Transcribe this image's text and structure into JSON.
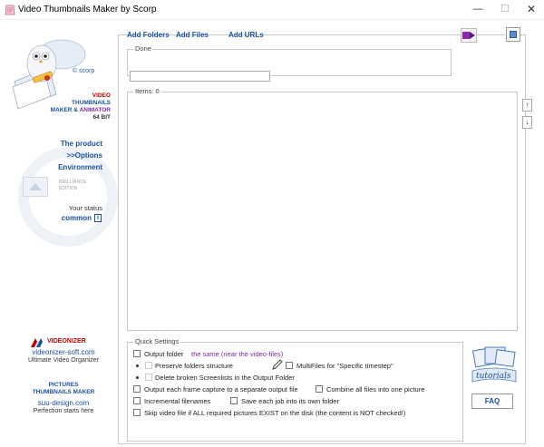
{
  "window": {
    "title": "Video Thumbnails Maker by Scorp",
    "minimize": "—",
    "maximize": "☐",
    "close": "✕"
  },
  "sidebar": {
    "scorp_label": "© scorp",
    "brand_line1": "VIDEO",
    "brand_line2": "THUMBNAILS",
    "brand_line3a": "MAKER & ",
    "brand_line3b": "ANIMATOR",
    "brand_line4": "64 BIT",
    "nav": [
      "The product",
      ">>Options",
      "Environment"
    ],
    "brilliance": "BRILLIANCE EDITION",
    "status_label": "Your status",
    "status_value": "common",
    "info_glyph": "i",
    "videonizer_title": "VIDEONIZER",
    "videonizer_url": "videonizer-soft.com",
    "videonizer_sub": "Ultimate Video Organizer",
    "pictures_title_1": "PICTURES",
    "pictures_title_2": "THUMBNAILS MAKER",
    "pictures_url": "suu-design.com",
    "pictures_sub": "Perfection starts here"
  },
  "toolbar": {
    "add_folders": "Add Folders",
    "add_files": "Add Files",
    "add_urls": "Add URLs"
  },
  "done_label": "Done",
  "items_label": "Items: 0",
  "arrows": {
    "up": "↑",
    "down": "↓"
  },
  "quick_settings": {
    "label": "Quick Settings",
    "output_folder": "Output folder",
    "output_folder_value": "the same (near the video-files)",
    "preserve": "Preserve folders structure",
    "multifiles": "MultiFiles for \"Specific timestep\"",
    "delete_broken": "Delete broken Screenlists in the Output Folder",
    "separate_output": "Output each frame capture to a separate output file",
    "combine": "Combine all files into one picture",
    "incremental": "Incremental filenames",
    "save_each": "Save each job into its own folder",
    "skip": "Skip video file if ALL required pictures EXIST on the disk (the content is NOT checked!)"
  },
  "tutorials_label": "tutorials",
  "faq_label": "FAQ",
  "colors": {
    "accent": "#1a4fa0",
    "brand_red": "#c00000",
    "purple": "#7a2aa8"
  }
}
